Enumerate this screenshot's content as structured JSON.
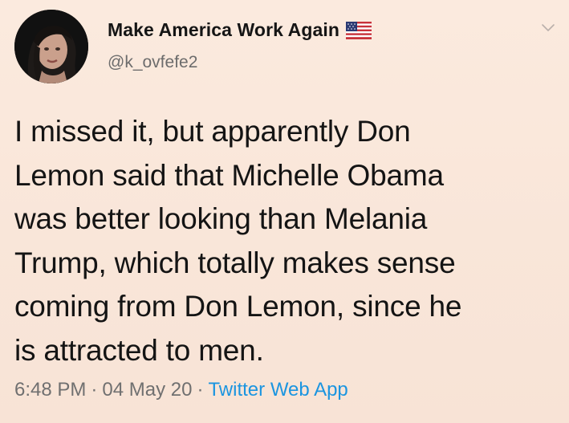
{
  "tweet": {
    "display_name": "Make America Work Again",
    "handle": "@k_ovfefe2",
    "badge_icon": "us-flag-icon",
    "menu_icon": "chevron-down-icon",
    "body_lines": [
      "I missed it, but apparently Don",
      "Lemon said that Michelle Obama",
      "was better looking than Melania",
      "Trump, which totally makes sense",
      "coming from Don Lemon, since he",
      "is attracted to men."
    ],
    "time": "6:48 PM",
    "date": "04 May 20",
    "separator": "·",
    "source": "Twitter Web App"
  },
  "colors": {
    "background": "#fbe9dd",
    "text": "#141414",
    "muted": "#707070",
    "link": "#1b95e0"
  }
}
